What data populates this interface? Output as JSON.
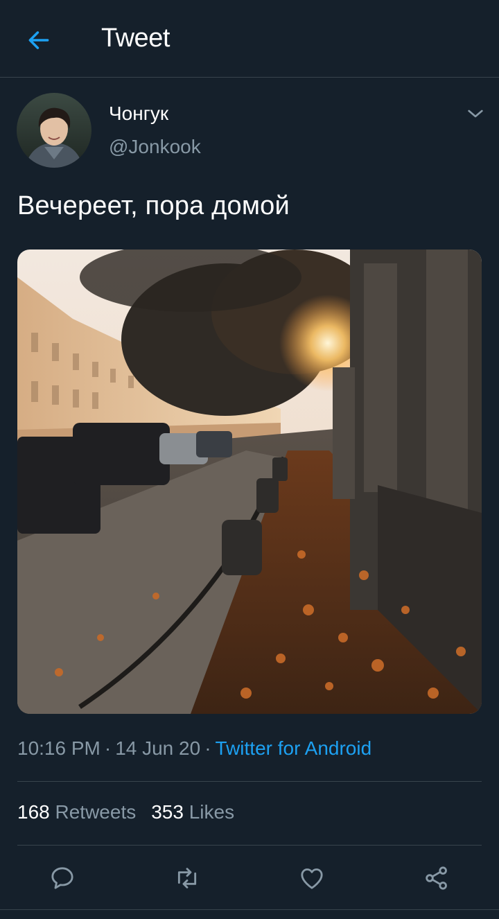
{
  "header": {
    "title": "Tweet",
    "back_icon": "arrow-left-icon",
    "accent": "#1da1f2"
  },
  "tweet": {
    "author_name": "Чонгук",
    "author_handle": "@Jonkook",
    "text": "Вечереет, пора домой",
    "time": "10:16 PM",
    "date": "14 Jun 20",
    "source": "Twitter for Android",
    "separator": "·"
  },
  "stats": {
    "retweets_count": "168",
    "retweets_label": "Retweets",
    "likes_count": "353",
    "likes_label": "Likes"
  },
  "actions": [
    "reply-icon",
    "retweet-icon",
    "like-icon",
    "share-icon"
  ],
  "colors": {
    "background": "#15202b",
    "secondary_text": "#8899a6",
    "divider": "#38444d",
    "link": "#1da1f2"
  }
}
